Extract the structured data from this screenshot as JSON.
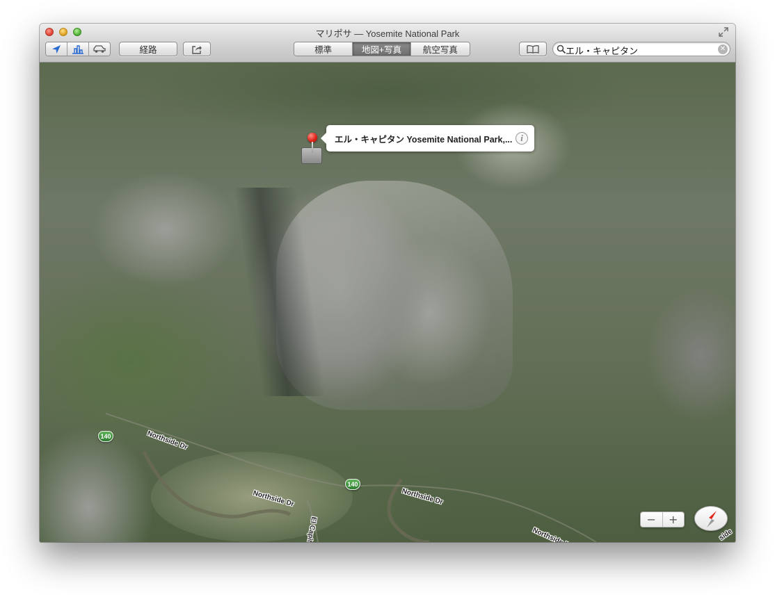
{
  "window": {
    "title": "マリポサ — Yosemite National Park"
  },
  "toolbar": {
    "directions_label": "経路",
    "map_modes": [
      "標準",
      "地図+写真",
      "航空写真"
    ],
    "selected_mode": "地図+写真"
  },
  "search": {
    "value": "エル・キャピタン"
  },
  "callout": {
    "text": "エル・キャピタン Yosemite National Park,...",
    "info_glyph": "i"
  },
  "map": {
    "route_shields": [
      "140",
      "140"
    ],
    "road_labels": [
      "Northside Dr",
      "Northside Dr",
      "Northside Dr",
      "Northside Dr",
      "El Capitan Dr"
    ],
    "partial_label": "side"
  },
  "controls": {
    "zoom_out": "−",
    "zoom_in": "+"
  },
  "colors": {
    "pin": "#e0251b",
    "route_shield": "#3a8a35",
    "active_segment": "#7a7a7a"
  },
  "icons": [
    "location-arrow-icon",
    "3d-buildings-icon",
    "traffic-car-icon",
    "share-icon",
    "bookmarks-book-icon",
    "search-icon",
    "clear-icon",
    "fullscreen-icon",
    "info-icon",
    "compass-icon"
  ]
}
